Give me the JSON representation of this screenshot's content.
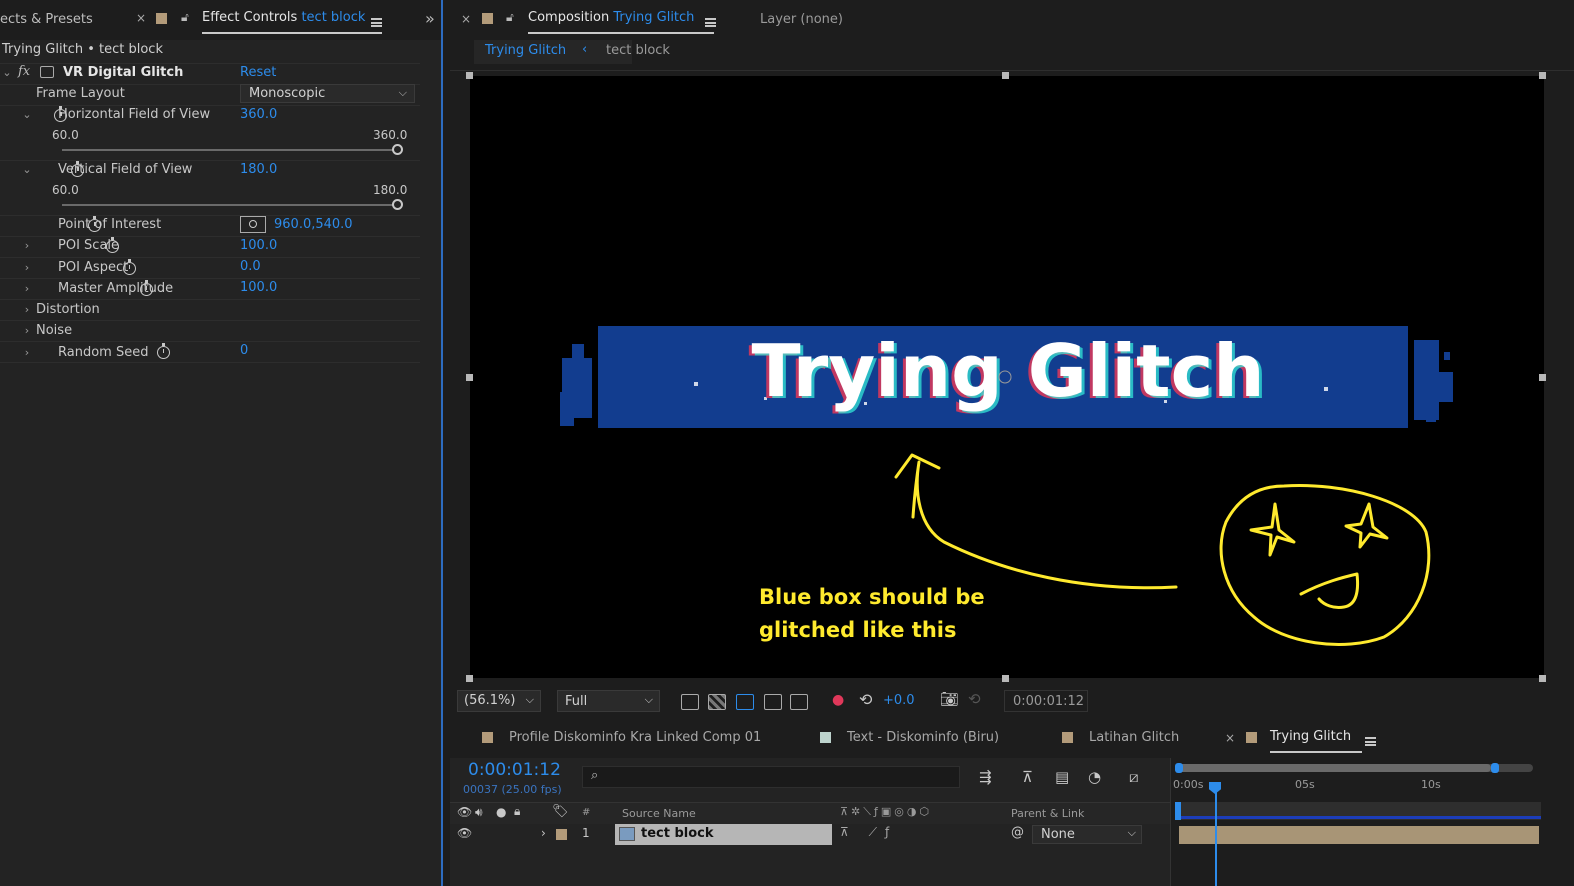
{
  "left_panel": {
    "tab_effects": "ects & Presets",
    "tab_effect_controls": "Effect Controls",
    "tab_effect_controls_layer": "tect block",
    "breadcrumb": "Trying Glitch • tect block",
    "effect_name": "VR Digital Glitch",
    "reset": "Reset",
    "fx_glyph": "fx",
    "props": {
      "frame_layout": {
        "label": "Frame Layout",
        "value": "Monoscopic"
      },
      "hfov": {
        "label": "Horizontal Field of View",
        "value": "360.0",
        "min": "60.0",
        "max": "360.0",
        "level": 1.0
      },
      "vfov": {
        "label": "Vertical Field of View",
        "value": "180.0",
        "min": "60.0",
        "max": "180.0",
        "level": 1.0
      },
      "poi": {
        "label": "Point of Interest",
        "value": "960.0,540.0"
      },
      "poi_scale": {
        "label": "POI Scale",
        "value": "100.0"
      },
      "poi_aspect": {
        "label": "POI Aspect",
        "value": "0.0"
      },
      "master_amp": {
        "label": "Master Amplitude",
        "value": "100.0"
      },
      "distortion": {
        "label": "Distortion"
      },
      "noise": {
        "label": "Noise"
      },
      "random_seed": {
        "label": "Random Seed",
        "value": "0"
      }
    }
  },
  "comp_panel": {
    "tab_prefix": "Composition",
    "tab_comp": "Trying Glitch",
    "layer_tab": "Layer  (none)",
    "crumb_1": "Trying Glitch",
    "crumb_2": "tect block",
    "viewer_text": "Trying Glitch",
    "annotation": [
      "Blue box should be",
      "glitched like this"
    ],
    "zoom": "(56.1%)",
    "resolution": "Full",
    "exposure": "+0.0",
    "timecode": "0:00:01:12"
  },
  "timeline": {
    "tabs": [
      "Profile Diskominfo Kra Linked Comp 01",
      "Text - Diskominfo (Biru)",
      "Latihan Glitch",
      "Trying Glitch"
    ],
    "timecode": "0:00:01:12",
    "frames": "00037 (25.00 fps)",
    "col_hash": "#",
    "col_source": "Source Name",
    "col_parent": "Parent & Link",
    "ruler": [
      "0:00s",
      "05s",
      "10s"
    ],
    "layer": {
      "num": "1",
      "name": "tect block",
      "parent": "None"
    }
  },
  "colors": {
    "accent_blue": "#2d8ceb",
    "label_tan": "#b39b7a",
    "annotation_yellow": "#ffea2e",
    "glitch_blue": "#123d8f"
  }
}
